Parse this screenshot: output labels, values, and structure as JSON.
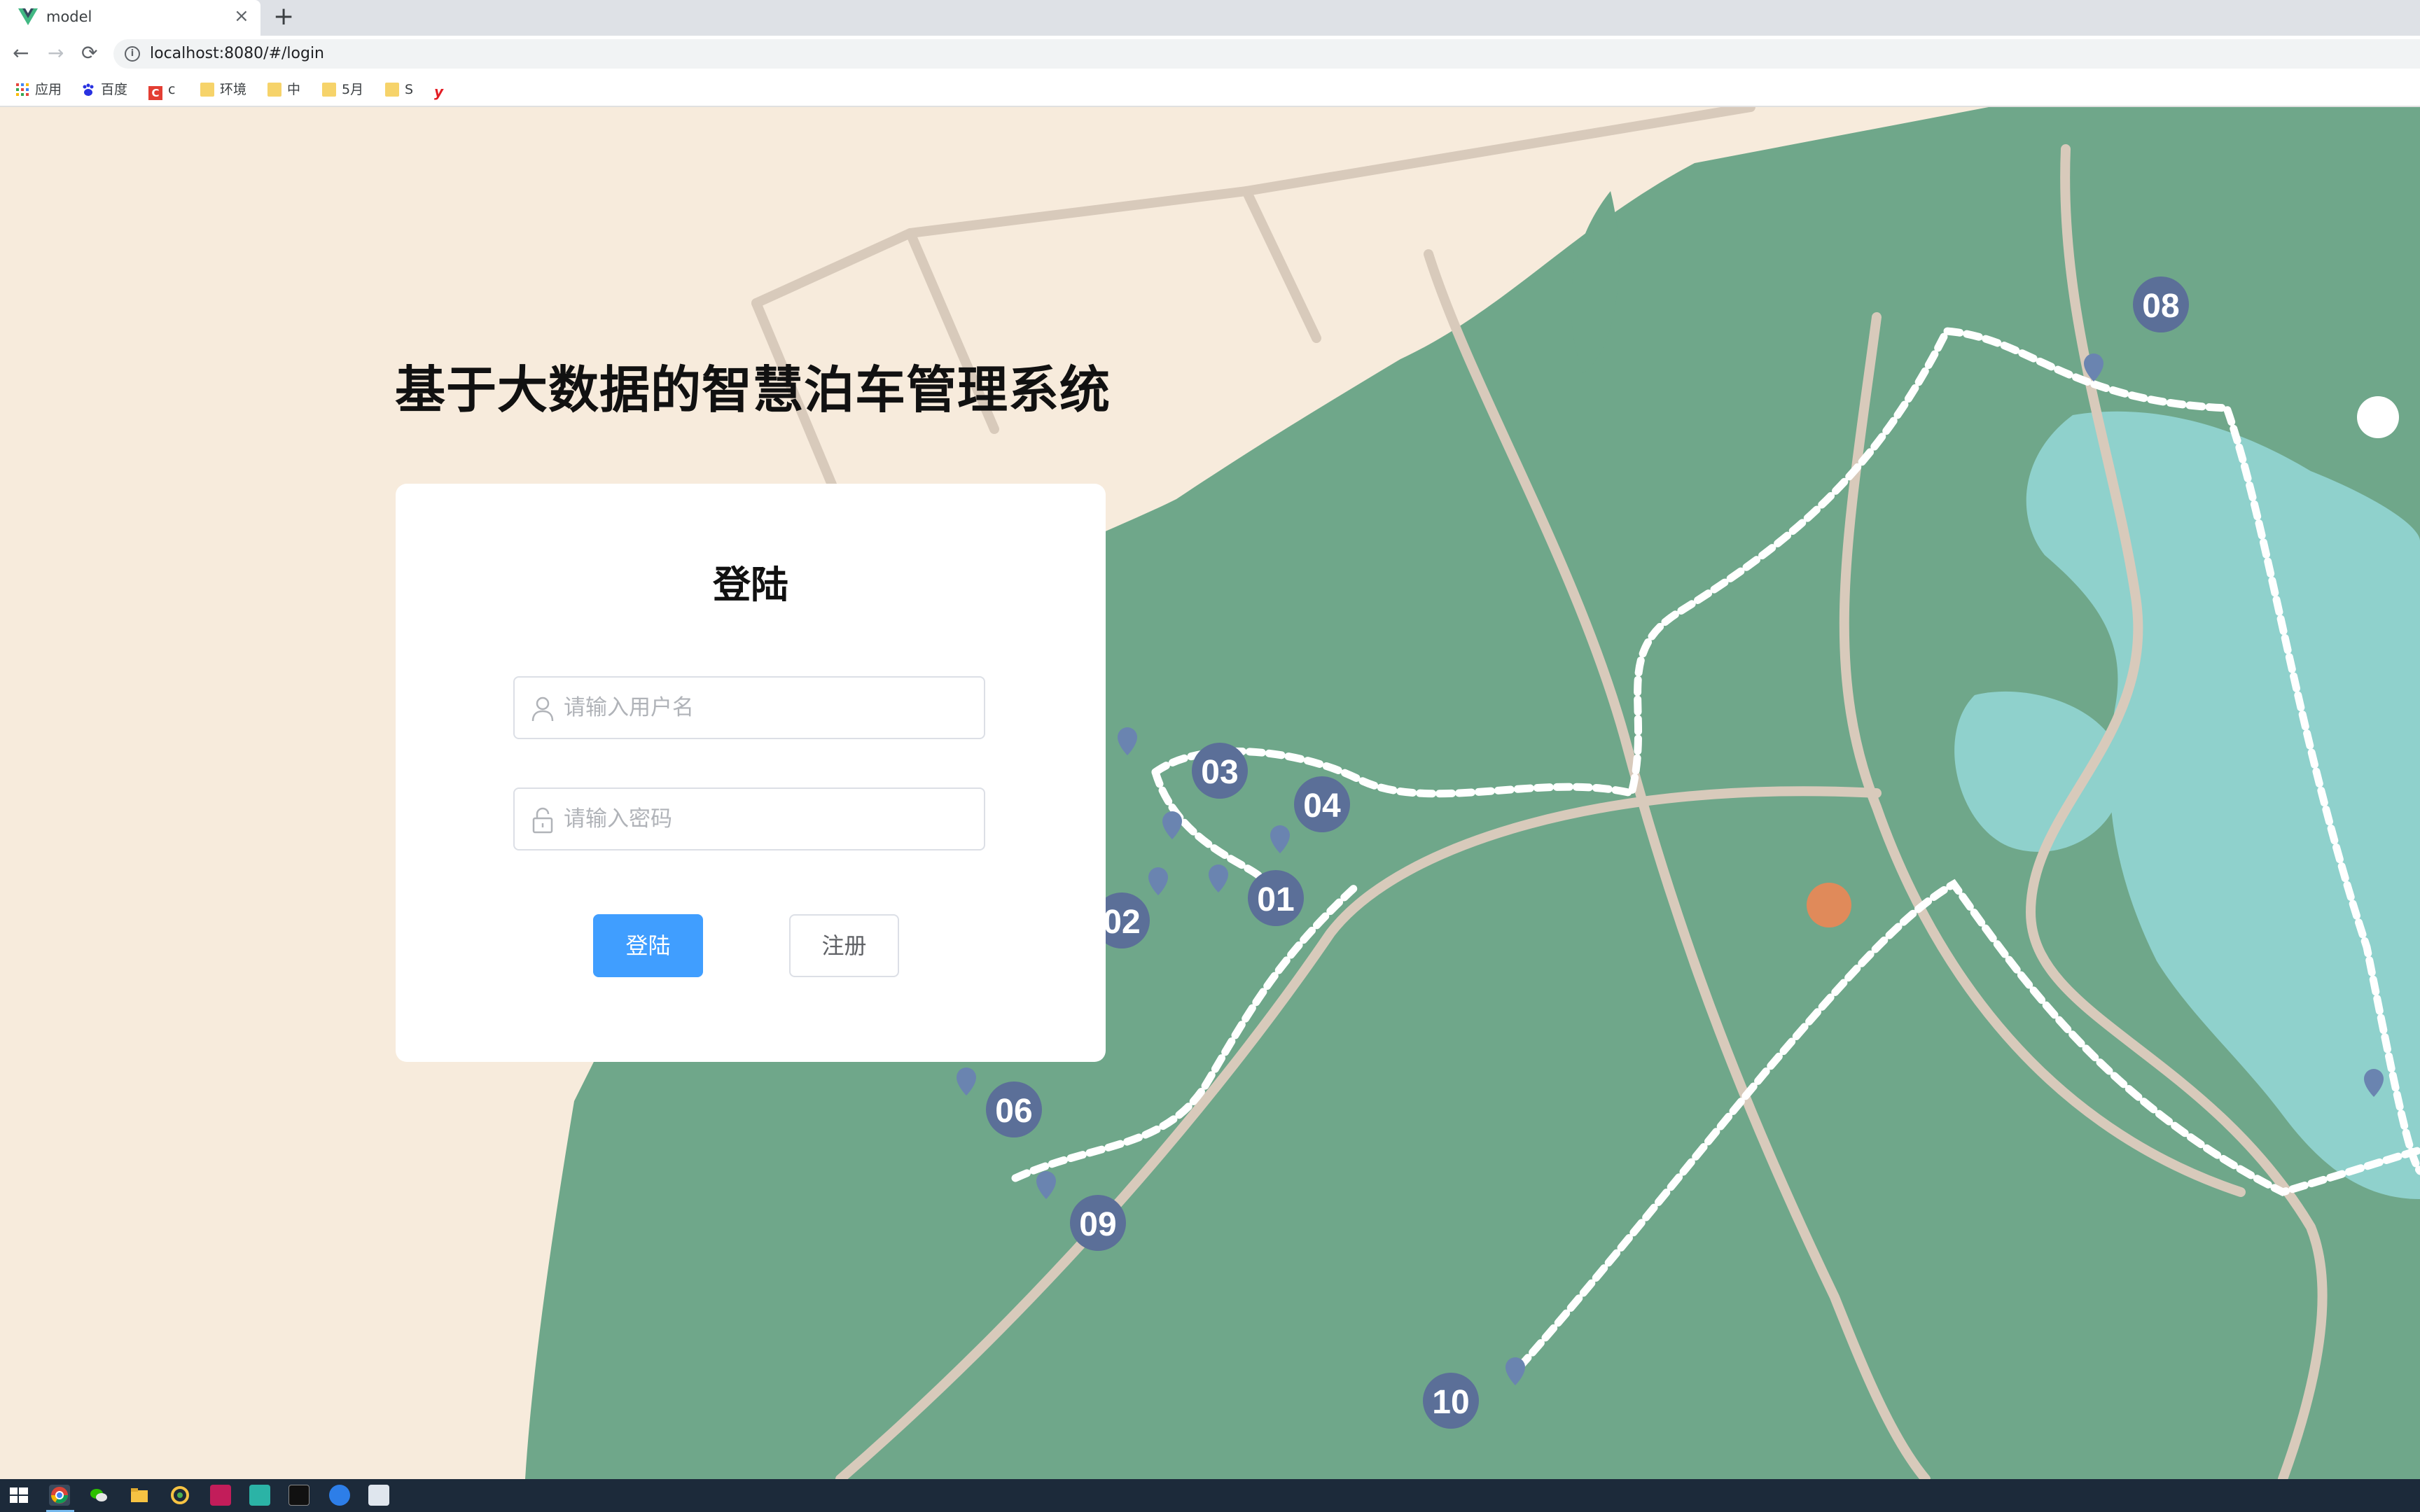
{
  "browser": {
    "tab_title": "model",
    "tab_close": "×",
    "new_tab": "+",
    "back": "←",
    "forward": "→",
    "reload": "⟳",
    "url": "localhost:8080/#/login"
  },
  "bookmarks": [
    {
      "label": "应用",
      "icon": "apps-grid-icon"
    },
    {
      "label": "百度",
      "icon": "baidu-icon"
    },
    {
      "label": "c",
      "icon": "csdn-icon"
    },
    {
      "label": "环境",
      "icon": "folder-icon"
    },
    {
      "label": "中",
      "icon": "folder-icon"
    },
    {
      "label": "5月",
      "icon": "folder-icon"
    },
    {
      "label": "S",
      "icon": "folder-icon"
    },
    {
      "label": "",
      "icon": "youdao-icon"
    }
  ],
  "page": {
    "title": "基于大数据的智慧泊车管理系统"
  },
  "login": {
    "heading": "登陆",
    "username_placeholder": "请输入用户名",
    "password_placeholder": "请输入密码",
    "login_button": "登陆",
    "register_button": "注册"
  },
  "map": {
    "markers": [
      "01",
      "02",
      "03",
      "04",
      "06",
      "08",
      "09",
      "10"
    ],
    "colors": {
      "land": "#f7ebdc",
      "park": "#6fa78a",
      "water": "#8fd1cc",
      "road": "#d8cabb",
      "marker": "#5b6f98"
    }
  },
  "colors": {
    "primary": "#409eff",
    "text": "#111111"
  }
}
